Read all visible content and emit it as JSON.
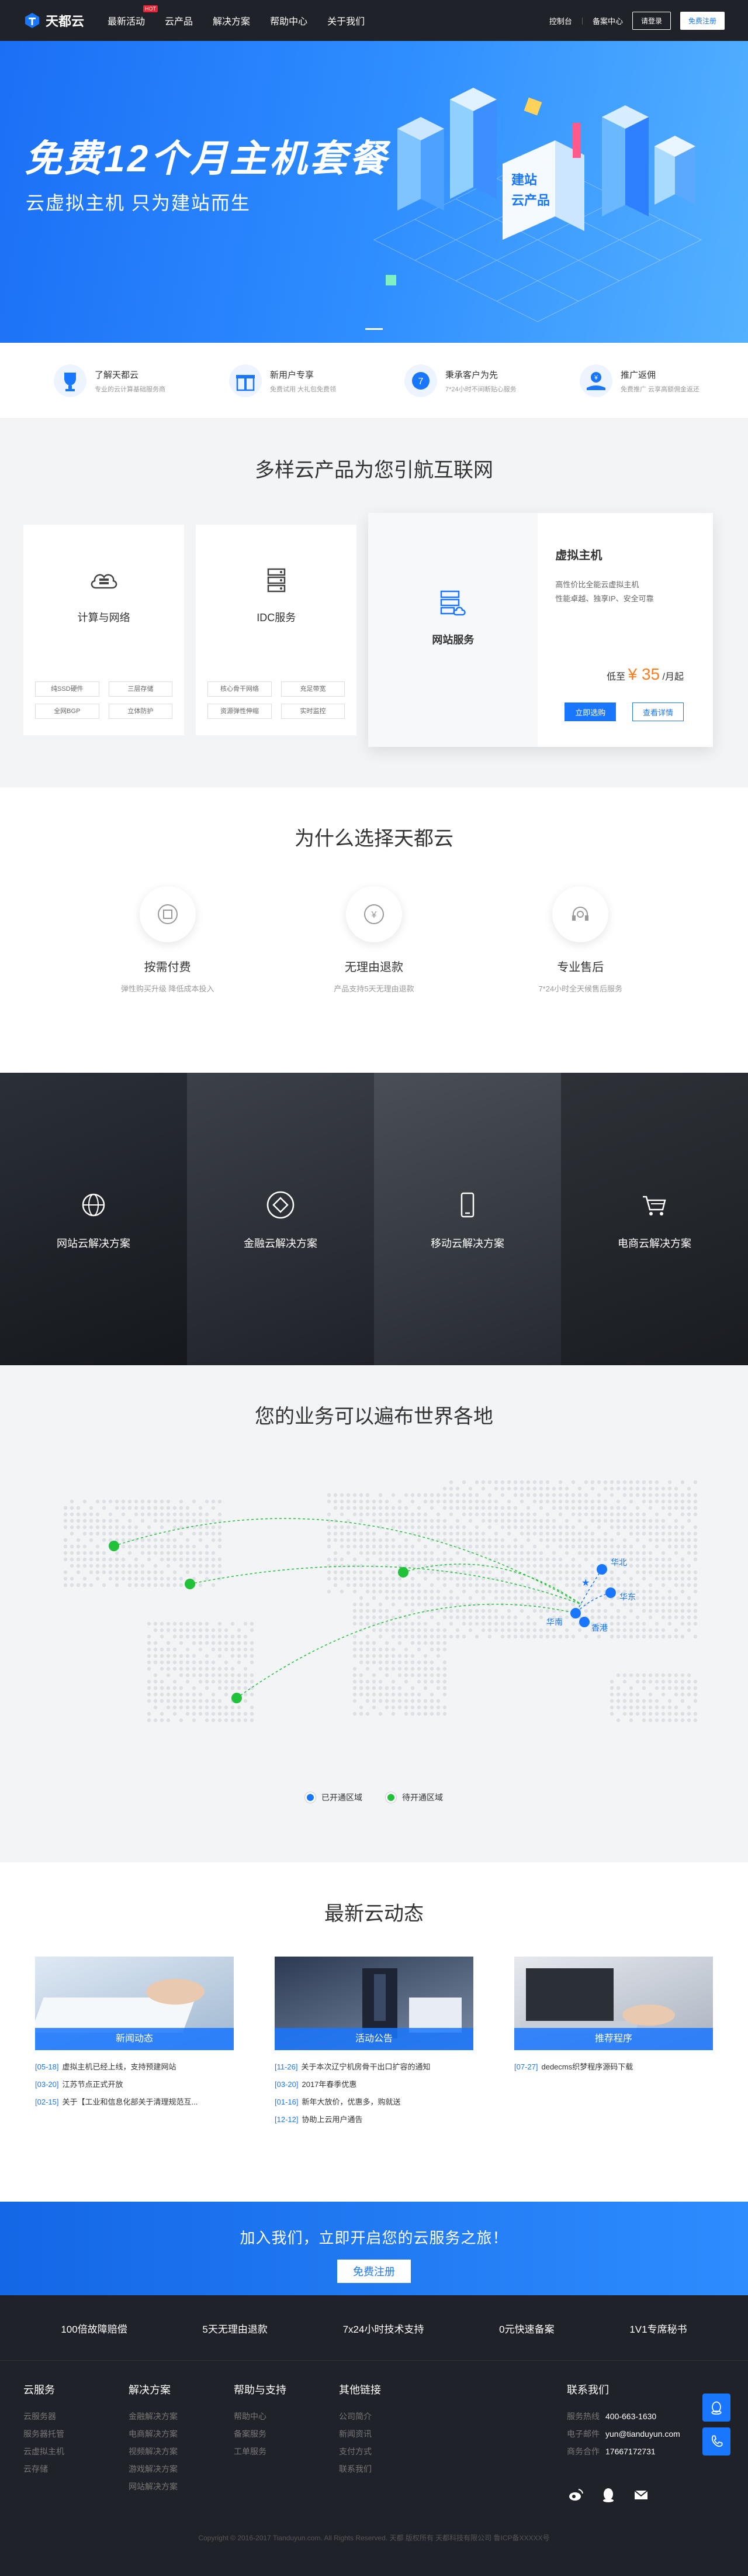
{
  "header": {
    "logo": "天都云",
    "nav": [
      {
        "label": "最新活动",
        "hot": "HOT"
      },
      {
        "label": "云产品"
      },
      {
        "label": "解决方案"
      },
      {
        "label": "帮助中心"
      },
      {
        "label": "关于我们"
      }
    ],
    "console": "控制台",
    "sep": "|",
    "help": "备案中心",
    "login": "请登录",
    "register": "免费注册"
  },
  "banner": {
    "title": "免费12个月主机套餐",
    "subtitle": "云虚拟主机  只为建站而生",
    "box_text_1": "建站",
    "box_text_2": "云产品"
  },
  "features": [
    {
      "title": "了解天都云",
      "desc": "专业的云计算基础服务商",
      "icon": "trophy-icon"
    },
    {
      "title": "新用户专享",
      "desc": "免费试用  大礼包免费领",
      "icon": "gift-icon"
    },
    {
      "title": "秉承客户为先",
      "desc": "7*24小时不间断贴心服务",
      "icon": "clock-icon"
    },
    {
      "title": "推广返佣",
      "desc": "免费推广  云享高额佣金返还",
      "icon": "money-hand-icon"
    }
  ],
  "products": {
    "title": "多样云产品为您引航互联网",
    "cards": [
      {
        "name": "计算与网络",
        "icon": "cloud-icon",
        "tags": [
          "纯SSD硬件",
          "三层存储",
          "全网BGP",
          "立体防护"
        ]
      },
      {
        "name": "IDC服务",
        "icon": "server-icon",
        "tags": [
          "核心骨干网络",
          "充足带宽",
          "资源弹性伸缩",
          "实时监控"
        ]
      }
    ],
    "featured": {
      "name": "网站服务",
      "icon": "server-cloud-icon",
      "title": "虚拟主机",
      "desc_1": "高性价比全能云虚拟主机",
      "desc_2": "性能卓越、独享IP、安全可靠",
      "price_prefix": "低至",
      "price": "¥ 35",
      "price_unit": "/月起",
      "buy": "立即选购",
      "detail": "查看详情"
    }
  },
  "why": {
    "title": "为什么选择天都云",
    "items": [
      {
        "title": "按需付费",
        "desc": "弹性购买升级 降低成本投入",
        "icon": "scale-icon"
      },
      {
        "title": "无理由退款",
        "desc": "产品支持5天无理由退款",
        "icon": "yen-icon"
      },
      {
        "title": "专业售后",
        "desc": "7*24小时全天候售后服务",
        "icon": "headset-icon"
      }
    ]
  },
  "solutions": [
    {
      "name": "网站云解决方案",
      "icon": "globe-icon",
      "bg1": "#2b3038",
      "bg2": "#15181c"
    },
    {
      "name": "金融云解决方案",
      "icon": "diamond-icon",
      "bg1": "#3c4048",
      "bg2": "#1f2228"
    },
    {
      "name": "移动云解决方案",
      "icon": "phone-icon",
      "bg1": "#4a4f57",
      "bg2": "#262a30"
    },
    {
      "name": "电商云解决方案",
      "icon": "cart-icon",
      "bg1": "#2e3238",
      "bg2": "#191c20"
    }
  ],
  "map": {
    "title": "您的业务可以遍布世界各地",
    "cities": [
      "华北",
      "华东",
      "华南",
      "香港"
    ],
    "legend_open": "已开通区域",
    "legend_soon": "待开通区域",
    "open_color": "#1976ff",
    "soon_color": "#21c13a"
  },
  "news": {
    "title": "最新云动态",
    "cols": [
      {
        "caption": "新闻动态",
        "rows": [
          {
            "date": "[05-18]",
            "text": "虚拟主机已经上线，支持预建网站"
          },
          {
            "date": "[03-20]",
            "text": "江苏节点正式开放"
          },
          {
            "date": "[02-15]",
            "text": "关于【工业和信息化部关于清理规范互..."
          }
        ]
      },
      {
        "caption": "活动公告",
        "rows": [
          {
            "date": "[11-26]",
            "text": "关于本次辽宁机房骨干出口扩容的通知"
          },
          {
            "date": "[03-20]",
            "text": "2017年春季优惠"
          },
          {
            "date": "[01-16]",
            "text": "新年大放价，优惠多，购就送"
          },
          {
            "date": "[12-12]",
            "text": "协助上云用户通告"
          }
        ]
      },
      {
        "caption": "推荐程序",
        "rows": [
          {
            "date": "[07-27]",
            "text": "dedecms织梦程序源码下载"
          }
        ]
      }
    ]
  },
  "join": {
    "title": "加入我们，立即开启您的云服务之旅！",
    "button": "免费注册"
  },
  "footer": {
    "guarantees": [
      "100倍故障赔偿",
      "5天无理由退款",
      "7x24小时技术支持",
      "0元快速备案",
      "1V1专席秘书"
    ],
    "cols": [
      {
        "title": "云服务",
        "links": [
          "云服务器",
          "服务器托管",
          "云虚拟主机",
          "云存储"
        ]
      },
      {
        "title": "解决方案",
        "links": [
          "金融解决方案",
          "电商解决方案",
          "视频解决方案",
          "游戏解决方案",
          "网站解决方案"
        ]
      },
      {
        "title": "帮助与支持",
        "links": [
          "帮助中心",
          "备案服务",
          "工单服务"
        ]
      },
      {
        "title": "其他链接",
        "links": [
          "公司简介",
          "新闻资讯",
          "支付方式",
          "联系我们"
        ]
      }
    ],
    "contact": {
      "title": "联系我们",
      "rows": [
        {
          "k": "服务热线",
          "v": "400-663-1630"
        },
        {
          "k": "电子邮件",
          "v": "yun@tianduyun.com"
        },
        {
          "k": "商务合作",
          "v": "17667172731"
        }
      ]
    },
    "copyright": "Copyright © 2016-2017 Tianduyun.com. All Rights Reserved. 天都 版权所有   天都科技有限公司   鲁ICP备XXXXX号"
  }
}
